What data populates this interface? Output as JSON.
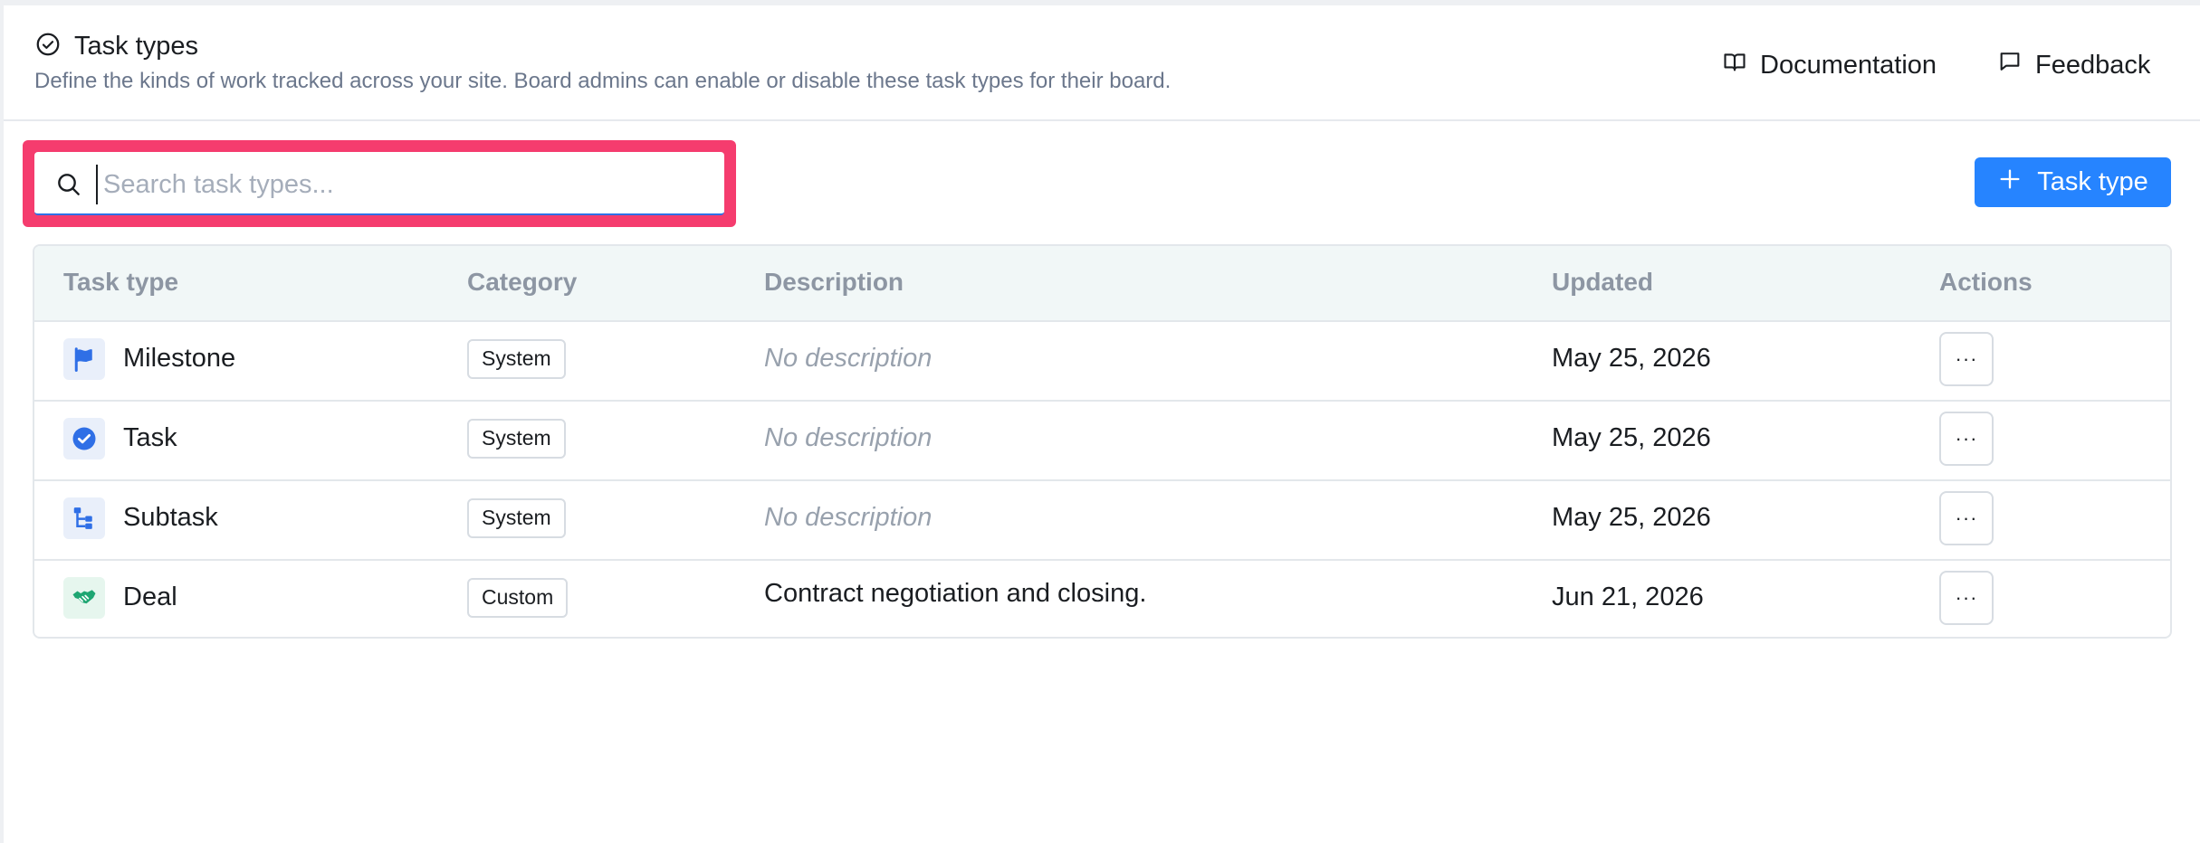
{
  "header": {
    "title": "Task types",
    "subtitle": "Define the kinds of work tracked across your site. Board admins can enable or disable these task types for their board.",
    "documentation_label": "Documentation",
    "feedback_label": "Feedback"
  },
  "search": {
    "placeholder": "Search task types...",
    "value": ""
  },
  "add_button_label": "Task type",
  "table": {
    "headers": {
      "task_type": "Task type",
      "category": "Category",
      "description": "Description",
      "updated": "Updated",
      "actions": "Actions"
    },
    "actions_label": "···",
    "rows": [
      {
        "icon": "flag-icon",
        "name": "Milestone",
        "category": "System",
        "description": "No description",
        "updated": "May 25, 2026"
      },
      {
        "icon": "check-circle-icon",
        "name": "Task",
        "category": "System",
        "description": "No description",
        "updated": "May 25, 2026"
      },
      {
        "icon": "subtask-icon",
        "name": "Subtask",
        "category": "System",
        "description": "No description",
        "updated": "May 25, 2026"
      },
      {
        "icon": "handshake-icon",
        "name": "Deal",
        "category": "Custom",
        "description": "Contract negotiation and closing.",
        "updated": "Jun 21, 2026"
      }
    ]
  },
  "colors": {
    "accent": "#2684ff",
    "highlight": "#f53c6e",
    "header_bg": "#f1f7f7",
    "system_icon": "#2f6fe6",
    "custom_icon": "#1ea672"
  }
}
